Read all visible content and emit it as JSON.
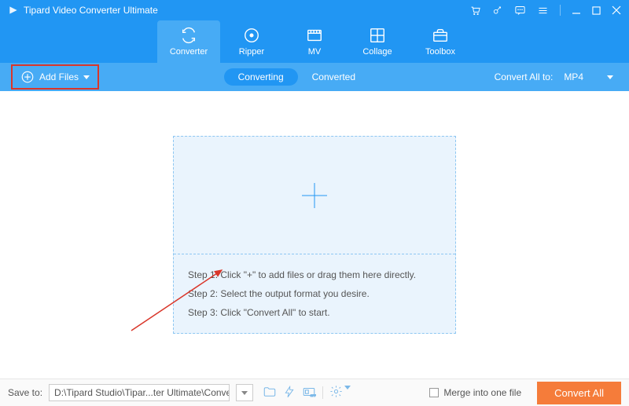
{
  "titlebar": {
    "title": "Tipard Video Converter Ultimate"
  },
  "nav": {
    "converter": "Converter",
    "ripper": "Ripper",
    "mv": "MV",
    "collage": "Collage",
    "toolbox": "Toolbox"
  },
  "subbar": {
    "addFiles": "Add Files",
    "converting": "Converting",
    "converted": "Converted",
    "convertAllTo": "Convert All to:",
    "format": "MP4"
  },
  "dropzone": {
    "step1": "Step 1: Click \"+\" to add files or drag them here directly.",
    "step2": "Step 2: Select the output format you desire.",
    "step3": "Step 3: Click \"Convert All\" to start."
  },
  "footer": {
    "saveToLabel": "Save to:",
    "savePath": "D:\\Tipard Studio\\Tipar...ter Ultimate\\Converted",
    "merge": "Merge into one file",
    "convertAll": "Convert All"
  }
}
